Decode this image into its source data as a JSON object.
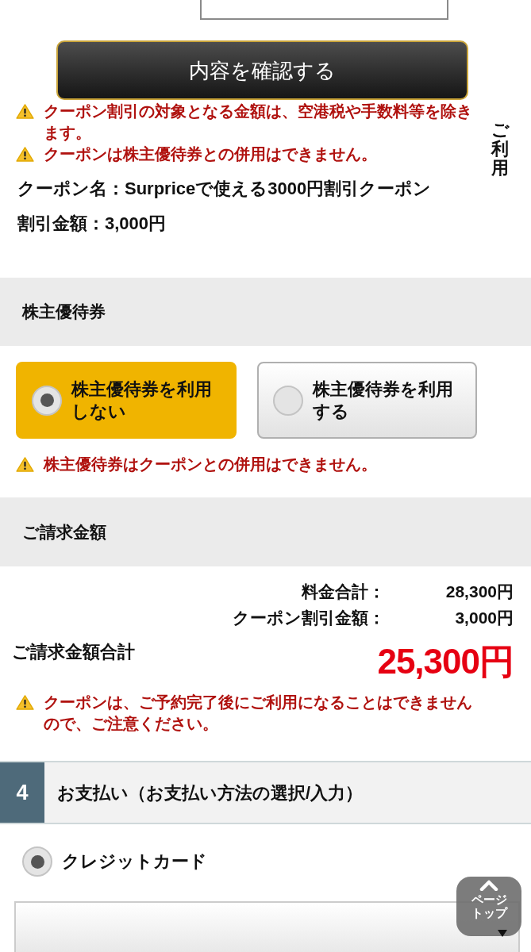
{
  "confirm_button": {
    "label": "内容を確認する"
  },
  "coupon_notes": [
    "クーポン割引の対象となる金額は、空港税や手数料等を除きます。",
    "クーポンは株主優待券との併用はできません。"
  ],
  "side_label": "ご利用",
  "coupon": {
    "name": "クーポン名：Surpriceで使える3000円割引クーポン",
    "discount": "割引金額：3,000円"
  },
  "shareholder": {
    "title": "株主優待券",
    "options": [
      {
        "label": "株主優待券を利用しない",
        "selected": true
      },
      {
        "label": "株主優待券を利用する",
        "selected": false
      }
    ],
    "note": "株主優待券はクーポンとの併用はできません。"
  },
  "billing": {
    "title": "ご請求金額",
    "rows": [
      {
        "label": "料金合計：",
        "value": "28,300円"
      },
      {
        "label": "クーポン割引金額：",
        "value": "3,000円"
      }
    ],
    "total_label": "ご請求金額合計",
    "total_value": "25,300円",
    "note": "クーポンは、ご予約完了後にご利用になることはできませんので、ご注意ください。"
  },
  "payment": {
    "step": "4",
    "title": "お支払い（お支払い方法の選択/入力）",
    "methods": [
      {
        "label": "クレジットカード",
        "selected": true
      }
    ]
  },
  "page_top_button": {
    "label": "ページトップ"
  }
}
